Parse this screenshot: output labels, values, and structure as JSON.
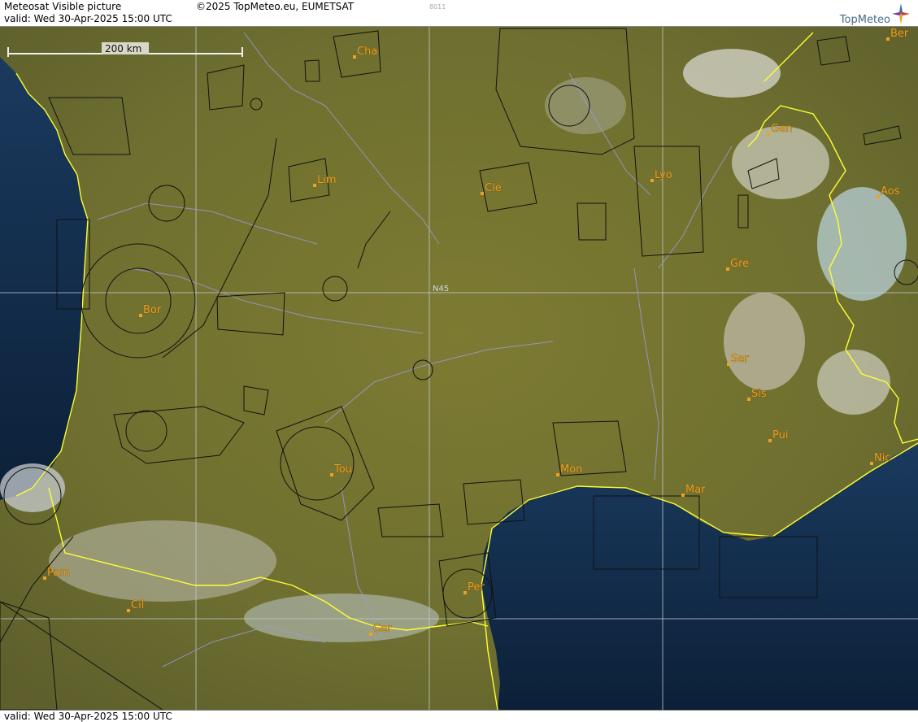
{
  "header": {
    "product_title": "Meteosat Visible picture",
    "copyright": "©2025 TopMeteo.eu, EUMETSAT",
    "valid": "valid:  Wed  30-Apr-2025  15:00 UTC",
    "image_code": "8011",
    "brand": "TopMeteo"
  },
  "footer": {
    "valid": "valid:  Wed  30-Apr-2025  15:00 UTC"
  },
  "map": {
    "scale_bar_label": "200 km",
    "latitude_label": "N45",
    "colors": {
      "sea": "#0f2a48",
      "land": "#7a7a30",
      "border": "#ffff33",
      "city": "#f2a020",
      "airspace": "#111111",
      "river": "#9a9ad8"
    },
    "cities": [
      {
        "name": "Cha"
      },
      {
        "name": "Ber"
      },
      {
        "name": "Gen"
      },
      {
        "name": "Lim"
      },
      {
        "name": "Cle"
      },
      {
        "name": "Lyo"
      },
      {
        "name": "Aos"
      },
      {
        "name": "Gre"
      },
      {
        "name": "Bor"
      },
      {
        "name": "Ser"
      },
      {
        "name": "Sis"
      },
      {
        "name": "Pui"
      },
      {
        "name": "Tou"
      },
      {
        "name": "Mon"
      },
      {
        "name": "Mar"
      },
      {
        "name": "Nic"
      },
      {
        "name": "Pam"
      },
      {
        "name": "Per"
      },
      {
        "name": "Cil"
      },
      {
        "name": "Cer"
      }
    ]
  }
}
